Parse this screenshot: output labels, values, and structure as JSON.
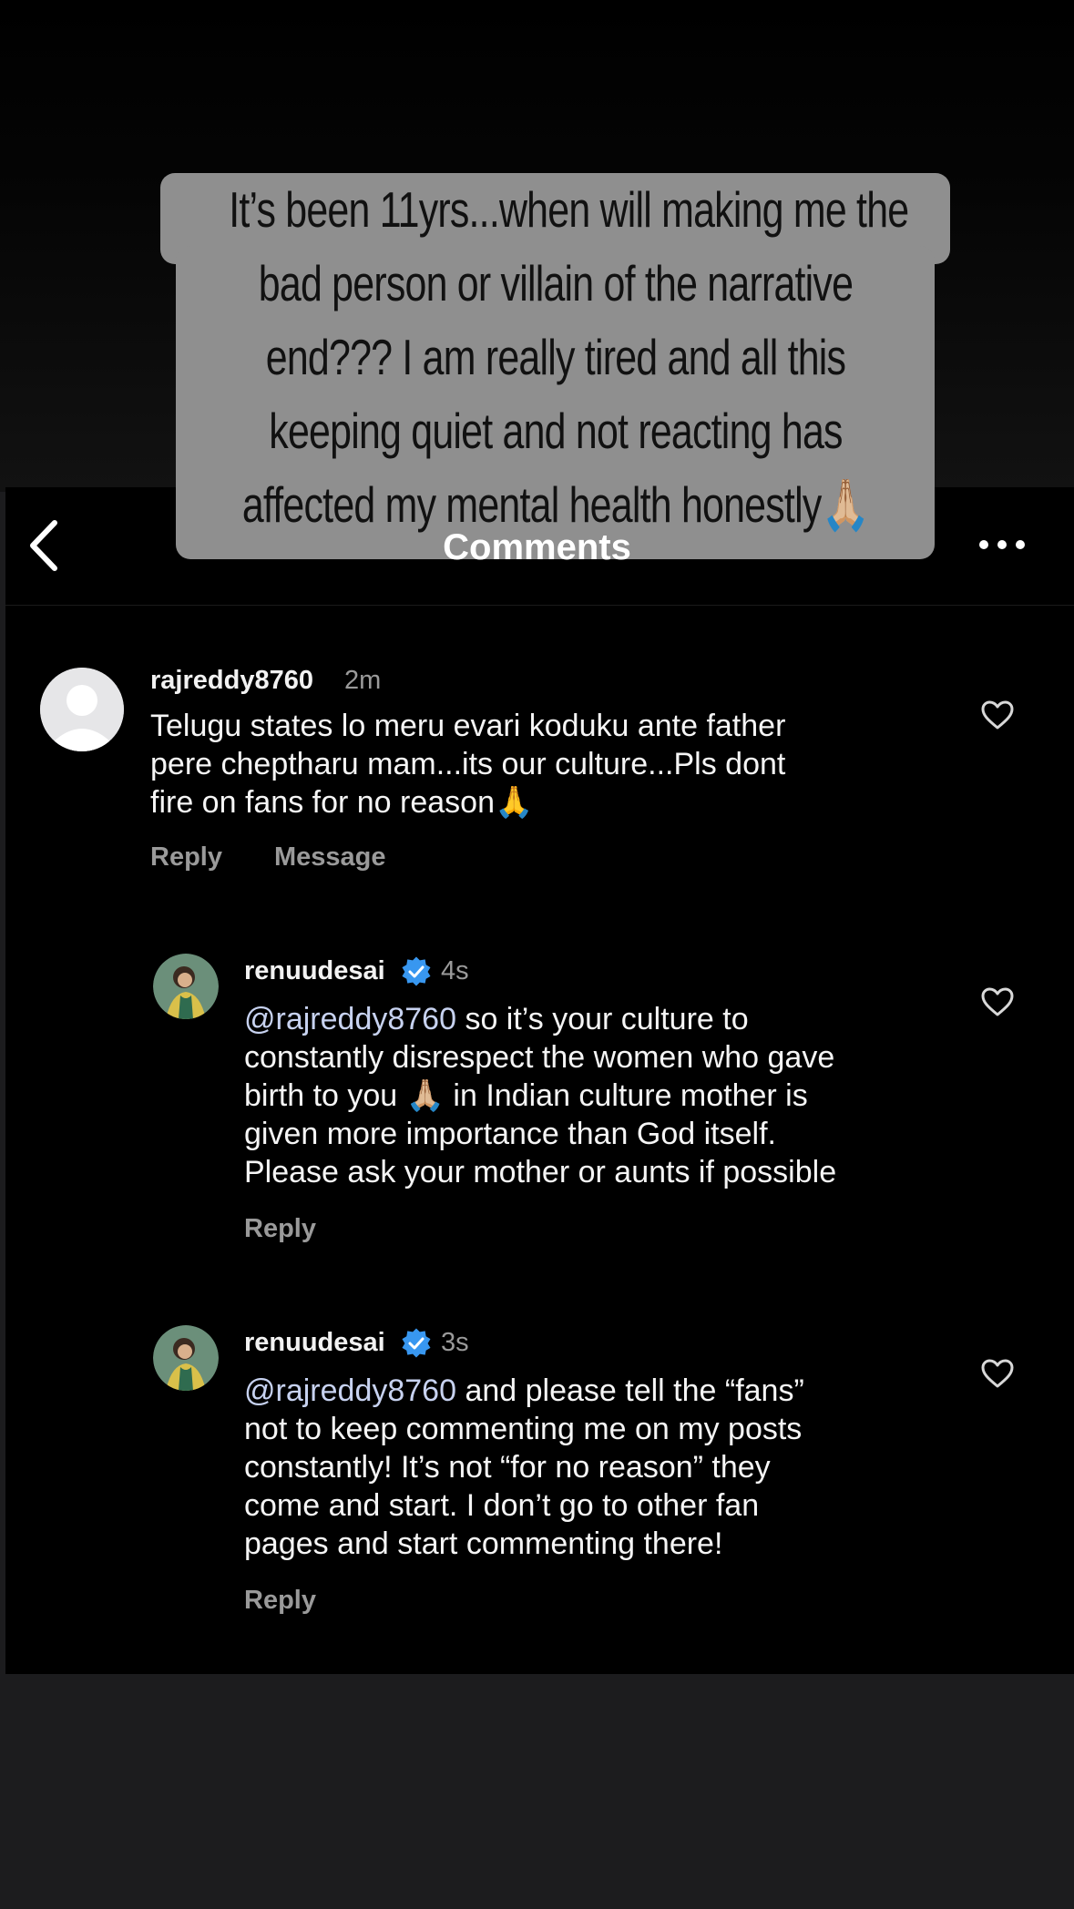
{
  "story_caption": {
    "lines": [
      "It’s been 11yrs...when will making me the",
      "bad person or villain of the narrative",
      "end??? I am really tired and all this",
      "keeping quiet and not reacting has",
      "affected my mental health honestly🙏🏼"
    ]
  },
  "header": {
    "title": "Comments",
    "back_icon": "chevron-left-icon",
    "more_icon": "ellipsis-icon"
  },
  "comments": [
    {
      "username": "rajreddy8760",
      "timestamp": "2m",
      "lines": [
        "Telugu states lo meru evari koduku ante father",
        "pere cheptharu mam...its our culture...Pls dont",
        "fire on fans for no reason🙏"
      ],
      "reply_label": "Reply",
      "message_label": "Message",
      "avatar_icon": "default-avatar-icon"
    },
    {
      "username": "renuudesai",
      "verified": true,
      "timestamp": "4s",
      "mention": "@rajreddy8760",
      "lines": [
        " so it’s your culture to",
        "constantly disrespect the women who gave",
        "birth to you 🙏🏼 in Indian culture mother is",
        "given more importance than God itself.",
        "Please ask your mother or aunts if possible"
      ],
      "reply_label": "Reply"
    },
    {
      "username": "renuudesai",
      "verified": true,
      "timestamp": "3s",
      "mention": "@rajreddy8760",
      "lines": [
        " and please tell the “fans”",
        "not to keep commenting me on my posts",
        "constantly! It’s not “for no reason” they",
        "come and start. I don’t go to other fan",
        "pages and start commenting there!"
      ],
      "reply_label": "Reply"
    }
  ],
  "colors": {
    "background": "#000000",
    "outer_background": "#1c1c1e",
    "caption_background": "#8f8f8f",
    "verified_badge": "#3897f0",
    "muted_text": "#9a9a9a"
  }
}
